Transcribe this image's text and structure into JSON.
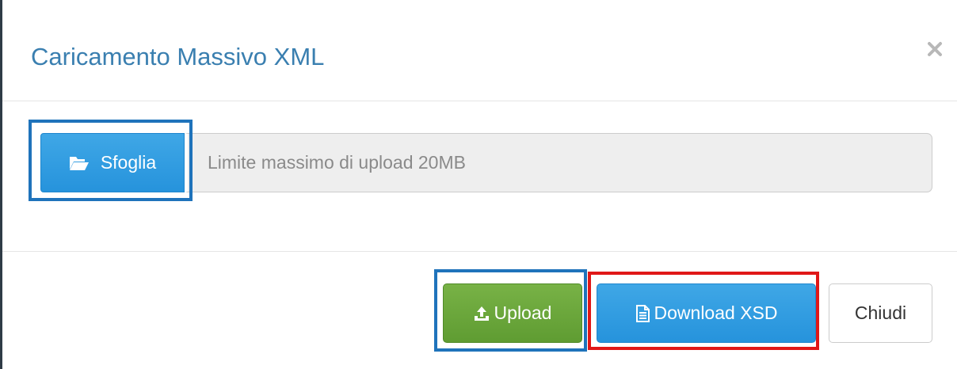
{
  "modal": {
    "title": "Caricamento Massivo XML",
    "close_icon": "times-icon"
  },
  "body": {
    "browse_label": "Sfoglia",
    "browse_icon": "folder-open-icon",
    "file_placeholder": "Limite massimo di upload 20MB"
  },
  "footer": {
    "upload_label": "Upload",
    "upload_icon": "upload-icon",
    "download_label": "Download XSD",
    "download_icon": "file-text-icon",
    "close_label": "Chiudi"
  },
  "colors": {
    "title": "#3a7fb0",
    "primary_button": "#2693dc",
    "success_button": "#5f9c32",
    "highlight_blue": "#1f73bb",
    "highlight_red": "#e01717"
  }
}
